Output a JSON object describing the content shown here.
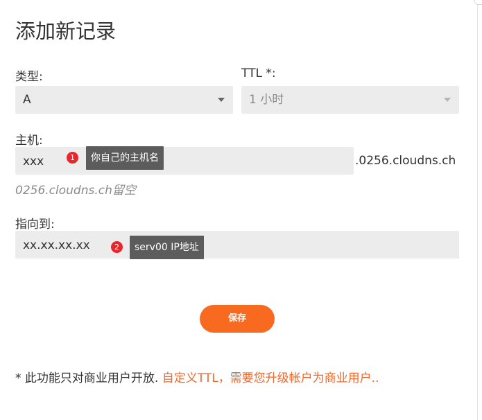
{
  "dialog": {
    "title": "添加新记录"
  },
  "type_field": {
    "label": "类型:",
    "value": "A"
  },
  "ttl_field": {
    "label": "TTL *:",
    "value": "1 小时"
  },
  "host_field": {
    "label": "主机:",
    "value": "xxx",
    "suffix": ".0256.cloudns.ch",
    "hint": "0256.cloudns.ch留空"
  },
  "points_to_field": {
    "label": "指向到:",
    "value": "xx.xx.xx.xx"
  },
  "annotations": [
    {
      "number": "1",
      "text": "你自己的主机名"
    },
    {
      "number": "2",
      "text": "serv00 IP地址"
    }
  ],
  "save_button": {
    "label": "保存"
  },
  "footer_note": {
    "text": "* 此功能只对商业用户开放.",
    "link": "自定义TTL，需要您升级帐户为商业用户.."
  },
  "colors": {
    "accent": "#f96a21",
    "badge": "#e8262c",
    "tooltip": "#5c5c5c",
    "field_bg": "#ececec"
  }
}
